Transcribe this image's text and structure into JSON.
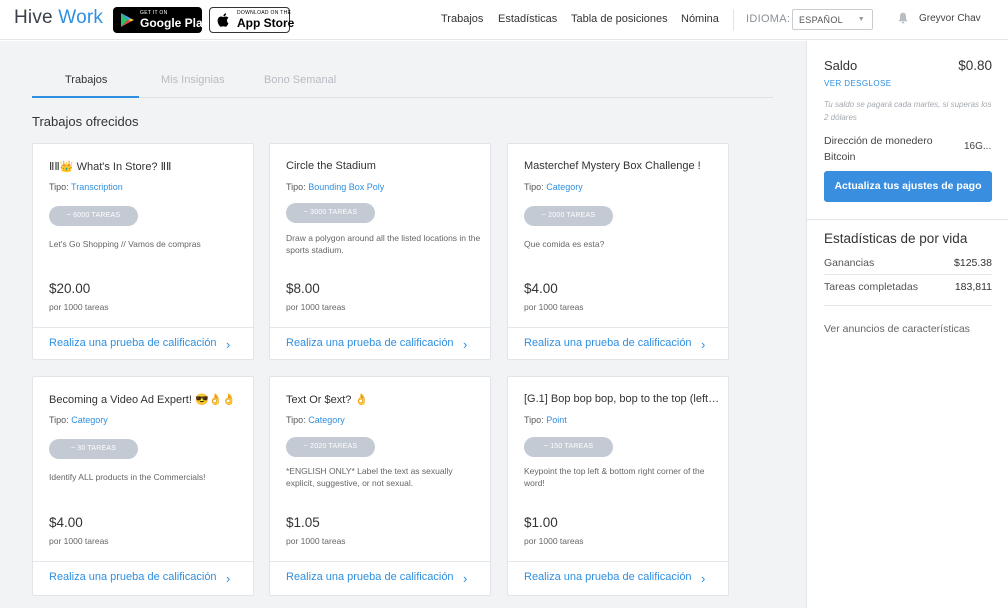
{
  "header": {
    "logo_main": "Hive",
    "logo_accent": "Work",
    "google_play": {
      "small": "GET IT ON",
      "big": "Google Play"
    },
    "app_store": {
      "small": "Download on the",
      "big": "App Store"
    },
    "nav": [
      "Trabajos",
      "Estadísticas",
      "Tabla de posiciones",
      "Nómina"
    ],
    "idioma_label": "IDIOMA:",
    "language": "ESPAÑOL",
    "user": "Greyvor Chav"
  },
  "tabs": [
    "Trabajos",
    "Mis Insignias",
    "Bono Semanal"
  ],
  "section_title": "Trabajos ofrecidos",
  "jobs": [
    {
      "title": "ⅡⅡ👑 What's In Store? ⅡⅡ",
      "type_label": "Tipo:",
      "type": "Transcription",
      "tasks": "~ 6000 TAREAS",
      "desc": "Let's Go Shopping // Vamos de compras",
      "price": "$20.00",
      "per": "por 1000 tareas",
      "cta": "Realiza una prueba de calificación"
    },
    {
      "title": "Circle the Stadium",
      "type_label": "Tipo:",
      "type": "Bounding Box Poly",
      "tasks": "~ 3000 TAREAS",
      "desc": "Draw a polygon around all the listed locations in the sports stadium.",
      "price": "$8.00",
      "per": "por 1000 tareas",
      "cta": "Realiza una prueba de calificación"
    },
    {
      "title": "Masterchef Mystery Box Challenge !",
      "type_label": "Tipo:",
      "type": "Category",
      "tasks": "~ 2000 TAREAS",
      "desc": "Que comida es esta?",
      "price": "$4.00",
      "per": "por 1000 tareas",
      "cta": "Realiza una prueba de calificación"
    },
    {
      "title": "Becoming a Video Ad Expert! 😎👌👌",
      "type_label": "Tipo:",
      "type": "Category",
      "tasks": "~ 30 TAREAS",
      "desc": "Identify ALL products in the Commercials!",
      "price": "$4.00",
      "per": "por 1000 tareas",
      "cta": "Realiza una prueba de calificación"
    },
    {
      "title": "Text Or $ext? 👌",
      "type_label": "Tipo:",
      "type": "Category",
      "tasks": "~ 2020 TAREAS",
      "desc": "*ENGLISH ONLY* Label the text as sexually explicit, suggestive, or not sexual.",
      "price": "$1.05",
      "per": "por 1000 tareas",
      "cta": "Realiza una prueba de calificación"
    },
    {
      "title": "[G.1] Bop bop bop, bop to the top (left ...",
      "type_label": "Tipo:",
      "type": "Point",
      "tasks": "~ 150 TAREAS",
      "desc": "Keypoint the top left & bottom right corner of the word!",
      "price": "$1.00",
      "per": "por 1000 tareas",
      "cta": "Realiza una prueba de calificación"
    }
  ],
  "sidebar": {
    "saldo_label": "Saldo",
    "saldo_value": "$0.80",
    "desglose": "VER DESGLOSE",
    "note": "Tu saldo se pagará cada martes, si superas los 2 dólares",
    "wallet_label": "Dirección de monedero Bitcoin",
    "wallet_value": "16G...",
    "button": "Actualiza tus ajustes de pago",
    "stats_title": "Estadísticas de por vida",
    "earnings_label": "Ganancias",
    "earnings_value": "$125.38",
    "tasks_label": "Tareas completadas",
    "tasks_value": "183,811",
    "features_link": "Ver anuncios de características"
  },
  "colors": {
    "accent": "#2f8fe0",
    "button": "#3a8ee0",
    "pill": "#c3cad3",
    "background": "#f2f3f5"
  }
}
